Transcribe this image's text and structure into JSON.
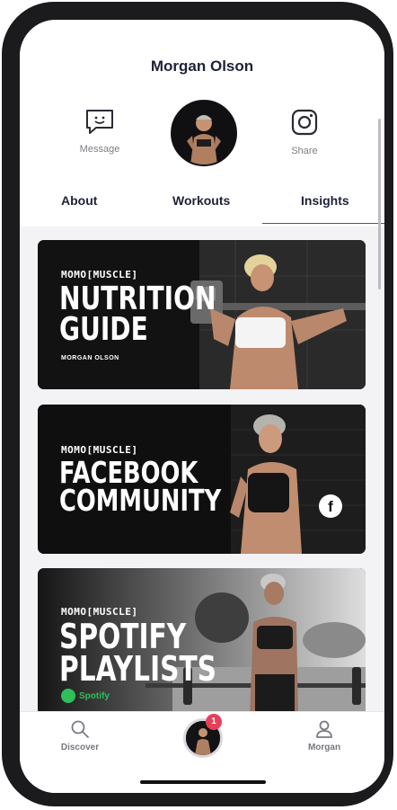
{
  "header": {
    "title": "Morgan Olson",
    "actions": [
      {
        "label": "Message",
        "icon": "message-smile-icon"
      },
      {
        "label": "Share",
        "icon": "instagram-icon"
      }
    ]
  },
  "tabs": [
    {
      "label": "About"
    },
    {
      "label": "Workouts"
    },
    {
      "label": "Insights",
      "active": true
    }
  ],
  "cards": [
    {
      "brand": "MOMO[MUSCLE]",
      "headline_lines": [
        "NUTRITION",
        "GUIDE"
      ],
      "sub": "MORGAN OLSON"
    },
    {
      "brand": "MOMO[MUSCLE]",
      "headline_lines": [
        "FACEBOOK",
        "COMMUNITY"
      ],
      "icon": "facebook-icon"
    },
    {
      "brand": "MOMO[MUSCLE]",
      "headline_lines": [
        "SPOTIFY",
        "PLAYLISTS"
      ],
      "spotify_label": "Spotify"
    }
  ],
  "bottom_nav": {
    "items": [
      {
        "label": "Discover",
        "icon": "search-icon"
      },
      {
        "label": "Morgan",
        "icon": "user-icon"
      }
    ],
    "badge_count": "1"
  },
  "colors": {
    "text_dark": "#1f2238",
    "muted": "#7d7e86",
    "badge": "#e83e5a",
    "spotify_green": "#2fbf5a"
  }
}
